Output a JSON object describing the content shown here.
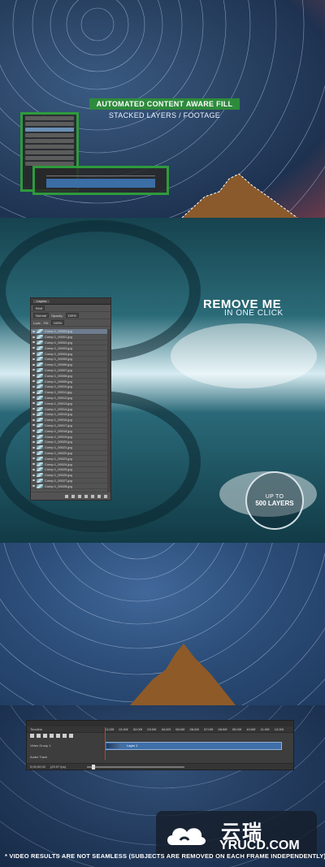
{
  "hero": {
    "banner_title": "AUTOMATED CONTENT AWARE FILL",
    "banner_subtitle": "STACKED LAYERS / FOOTAGE"
  },
  "remove": {
    "title": "REMOVE ME",
    "subtitle": "IN ONE CLICK",
    "badge_line1": "UP TO",
    "badge_line2": "500 LAYERS"
  },
  "layers_panel": {
    "tab": "Layers",
    "kind_filter": "Kind",
    "blend_mode": "Normal",
    "opacity_label": "Opacity:",
    "opacity_value": "100%",
    "lock_label": "Lock:",
    "fill_label": "Fill:",
    "fill_value": "100%",
    "layer_names": [
      "Comp 1_00000.jpg",
      "Comp 1_00001.jpg",
      "Comp 1_00002.jpg",
      "Comp 1_00003.jpg",
      "Comp 1_00004.jpg",
      "Comp 1_00005.jpg",
      "Comp 1_00006.jpg",
      "Comp 1_00007.jpg",
      "Comp 1_00008.jpg",
      "Comp 1_00009.jpg",
      "Comp 1_00010.jpg",
      "Comp 1_00011.jpg",
      "Comp 1_00012.jpg",
      "Comp 1_00013.jpg",
      "Comp 1_00014.jpg",
      "Comp 1_00015.jpg",
      "Comp 1_00016.jpg",
      "Comp 1_00017.jpg",
      "Comp 1_00018.jpg",
      "Comp 1_00019.jpg",
      "Comp 1_00020.jpg",
      "Comp 1_00021.jpg",
      "Comp 1_00022.jpg",
      "Comp 1_00023.jpg",
      "Comp 1_00024.jpg",
      "Comp 1_00025.jpg",
      "Comp 1_00026.jpg",
      "Comp 1_00027.jpg",
      "Comp 1_00028.jpg"
    ]
  },
  "timeline": {
    "header": "Timeline",
    "ruler": [
      "01:00f",
      "01:00f",
      "02:00f",
      "03:00f",
      "04:00f",
      "05:00f",
      "06:00f",
      "07:00f",
      "08:00f",
      "09:00f",
      "10:00f",
      "11:00f",
      "12:00f"
    ],
    "group_label": "Video Group 1",
    "clip_label": "Layer 1",
    "audio_label": "Audio Track",
    "timecode": "0;00;00;00",
    "fps": "(29.97 fps)"
  },
  "watermark": {
    "cn": "云瑞",
    "en": "YRUCD.COM"
  },
  "footer": {
    "disclaimer": "* VIDEO RESULTS ARE NOT SEAMLESS (SUBJECTS ARE REMOVED ON EACH FRAME INDEPENDENTLY)"
  },
  "colors": {
    "accent_green": "#2e8b3c",
    "selection_blue": "#3f6fa8",
    "panel_gray": "#535353"
  }
}
